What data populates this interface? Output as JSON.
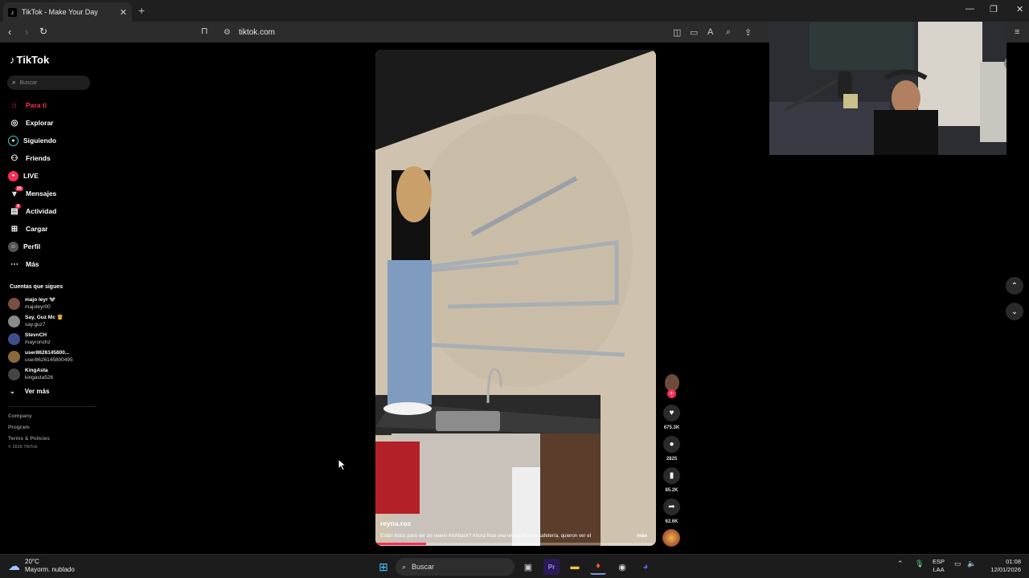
{
  "browser": {
    "tab_title": "TikTok - Make Your Day",
    "tab_close": "✕",
    "new_tab": "+",
    "url": "tikto k.com",
    "window_controls": [
      "—",
      "❐",
      "✕"
    ]
  },
  "sidebar": {
    "brand": "TikTok",
    "search_placeholder": "Buscar",
    "nav": [
      {
        "label": "Para ti",
        "icon": "home-icon",
        "active": true
      },
      {
        "label": "Explorar",
        "icon": "compass-icon"
      },
      {
        "label": "Siguiendo",
        "icon": "following-icon"
      },
      {
        "label": "Friends",
        "icon": "friends-icon"
      },
      {
        "label": "LIVE",
        "icon": "live-icon"
      },
      {
        "label": "Mensajes",
        "icon": "messages-icon",
        "badge": "16"
      },
      {
        "label": "Actividad",
        "icon": "activity-icon",
        "badge": "4"
      },
      {
        "label": "Cargar",
        "icon": "upload-icon"
      },
      {
        "label": "Perfil",
        "icon": "profile-icon"
      },
      {
        "label": "Más",
        "icon": "more-icon"
      }
    ],
    "following_title": "Cuentas que sigues",
    "accounts": [
      {
        "name": "majo leyr 🐭",
        "handle": "majoleyr00"
      },
      {
        "name": "Say, Guz Mc 👸",
        "handle": "say.guz7"
      },
      {
        "name": "StevnCH",
        "handle": "mayronchz"
      },
      {
        "name": "user8626145800...",
        "handle": "user8626145800495"
      },
      {
        "name": "KingAsta",
        "handle": "kingasta526"
      }
    ],
    "see_more": "Ver más",
    "footer": [
      "Company",
      "Program",
      "Terms & Policies",
      "© 2026 TikTok"
    ]
  },
  "video": {
    "username": "reyna.ros",
    "description": "Están listos para ver un nuevo ArtAttack? Ahora hice una repisa en una cafetería, quieron ver el",
    "more": "más",
    "progress": 0.18,
    "likes": "675.3K",
    "comments": "2825",
    "saves": "85.2K",
    "shares": "62.6K"
  },
  "taskbar": {
    "temp": "20°C",
    "weather": "Mayorm. nublado",
    "search": "Buscar",
    "lang1": "ESP",
    "lang2": "LAA",
    "time": "01:08",
    "date": "12/01/2026"
  },
  "colors": {
    "accent": "#fe2c55",
    "background": "#000000"
  }
}
